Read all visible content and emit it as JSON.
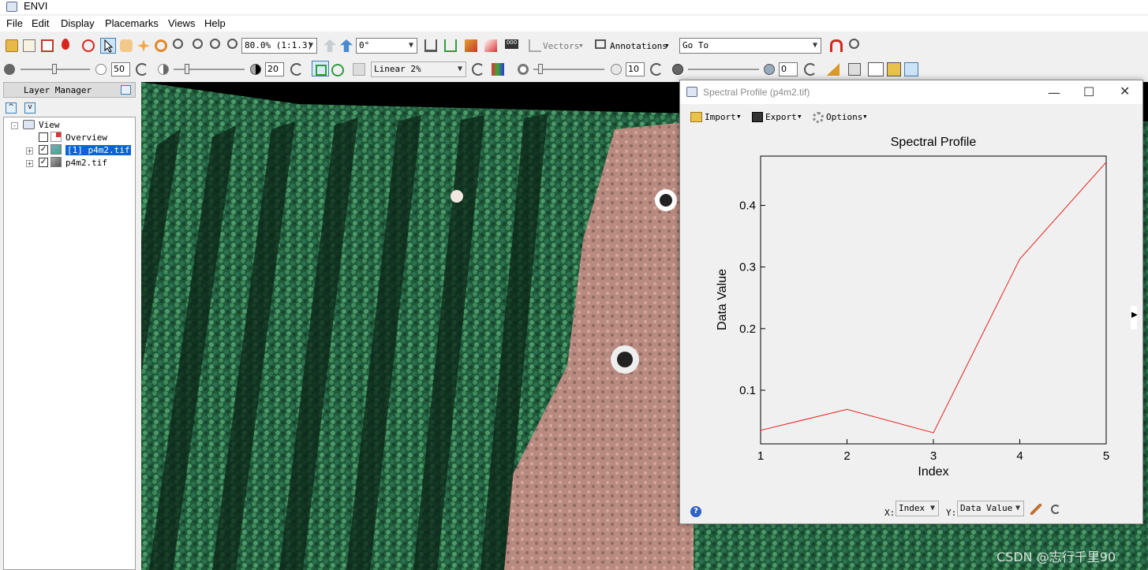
{
  "app": {
    "title": "ENVI"
  },
  "menu": [
    "File",
    "Edit",
    "Display",
    "Placemarks",
    "Views",
    "Help"
  ],
  "toolbar1": {
    "zoom": "80.0% (1:1.3)",
    "rotation": "0°",
    "vectors_label": "Vectors",
    "annotations_label": "Annotations",
    "goto_label": "Go To"
  },
  "toolbar2": {
    "brightness": "50",
    "contrast": "20",
    "stretch": "Linear 2%",
    "sharpen": "10",
    "transparency": "0"
  },
  "layer_manager": {
    "title": "Layer Manager",
    "tree": [
      {
        "label": "View",
        "checked": null
      },
      {
        "label": "Overview",
        "checked": false
      },
      {
        "label": "[1] p4m2.tif",
        "checked": true,
        "selected": true
      },
      {
        "label": "p4m2.tif",
        "checked": true,
        "selected": false
      }
    ]
  },
  "dialog": {
    "title": "Spectral Profile (p4m2.tif)",
    "import_label": "Import",
    "export_label": "Export",
    "options_label": "Options",
    "x_prefix": "X:",
    "x_value": "Index",
    "y_prefix": "Y:",
    "y_value": "Data Value"
  },
  "chart_data": {
    "type": "line",
    "title": "Spectral Profile",
    "xlabel": "Index",
    "ylabel": "Data Value",
    "x": [
      1,
      2,
      3,
      4,
      5
    ],
    "xticks": [
      "1",
      "2",
      "3",
      "4",
      "5"
    ],
    "yticks": [
      "0.1",
      "0.2",
      "0.3",
      "0.4"
    ],
    "xlim": [
      1,
      5
    ],
    "ylim": [
      0.013,
      0.48
    ],
    "series": [
      {
        "values": [
          0.035,
          0.069,
          0.031,
          0.313,
          0.47
        ],
        "color": "#e8201c"
      }
    ],
    "grid": false
  },
  "watermark": "CSDN @志行千里90"
}
